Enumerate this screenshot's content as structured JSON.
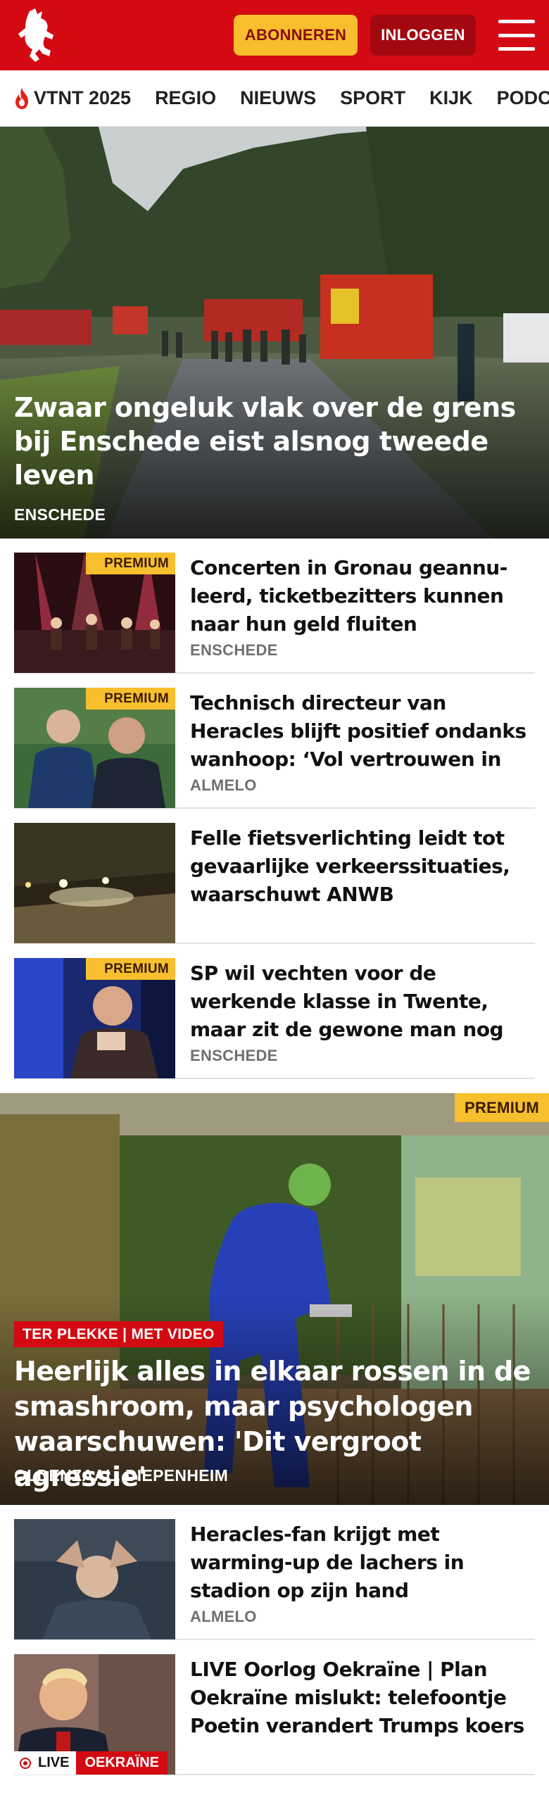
{
  "header": {
    "logo_icon": "tubantia-horse-logo-icon",
    "subscribe_label": "ABONNEREN",
    "login_label": "INLOGGEN",
    "menu_icon": "hamburger-menu-icon",
    "colors": {
      "brand_red": "#d40a12",
      "subscribe_yellow": "#f7be2d",
      "login_dark_red": "#a30810"
    }
  },
  "nav": {
    "items": [
      {
        "label": "VTNT 2025",
        "icon": "flame-icon"
      },
      {
        "label": "REGIO"
      },
      {
        "label": "NIEUWS"
      },
      {
        "label": "SPORT"
      },
      {
        "label": "KIJK"
      },
      {
        "label": "PODCAST"
      }
    ]
  },
  "hero": {
    "title": "Zwaar ongeluk vlak over de grens bij Enschede eist alsnog tweede leven",
    "place": "ENSCHEDE",
    "image": "accident-scene-fire-trucks-photo"
  },
  "articles": [
    {
      "badge": "PREMIUM",
      "title": "Concerten in Gronau geannu­leerd, ticketbezitters kunnen naar hun geld fluiten",
      "place": "ENSCHEDE",
      "image": "concert-stage-photo"
    },
    {
      "badge": "PREMIUM",
      "title": "Technisch directeur van Heracles blijft positief ondanks wanhoop: ‘Vol vertrouwen in deze selectie…",
      "place": "ALMELO",
      "image": "heracles-staff-photo"
    },
    {
      "badge": "",
      "title": "Felle fietsverlichting leidt tot gevaarlijke verkeerssituaties, waarschuwt ANWB",
      "place": "",
      "image": "bike-lights-night-photo"
    },
    {
      "badge": "PREMIUM",
      "title": "SP wil vechten voor de werkende klasse in Twente, maar zit de gewone man nog op de SP te…",
      "place": "ENSCHEDE",
      "image": "sp-politician-photo"
    }
  ],
  "featured": {
    "badge": "PREMIUM",
    "label": "TER PLEKKE | MET VIDEO",
    "title": "Heerlijk alles in elkaar rossen in de smashroom, maar psychologen waarschuwen: 'Dit vergroot agressie'",
    "place": "OLDENZAAL, DIEPENHEIM",
    "image": "smashroom-photo"
  },
  "articles2": [
    {
      "title": "Heracles-fan krijgt met warming-up de lachers in stadion op zijn hand",
      "place": "ALMELO",
      "image": "heracles-player-photo"
    },
    {
      "title": "LIVE Oorlog Oekraïne | Plan Oekraïne mislukt: telefoontje Poetin verandert Trumps koers",
      "place": "",
      "image": "trump-photo",
      "live_label": "LIVE",
      "topic_label": "OEKRAÏNE"
    }
  ]
}
